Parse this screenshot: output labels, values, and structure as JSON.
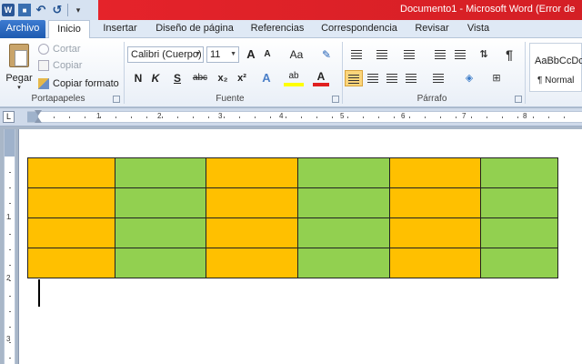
{
  "window": {
    "title": "Documento1  -  Microsoft Word (Error de"
  },
  "tabs": [
    {
      "id": "file",
      "label": "Archivo"
    },
    {
      "id": "home",
      "label": "Inicio"
    },
    {
      "id": "insert",
      "label": "Insertar"
    },
    {
      "id": "layout",
      "label": "Diseño de página"
    },
    {
      "id": "refs",
      "label": "Referencias"
    },
    {
      "id": "mail",
      "label": "Correspondencia"
    },
    {
      "id": "review",
      "label": "Revisar"
    },
    {
      "id": "view",
      "label": "Vista"
    }
  ],
  "clipboard": {
    "paste": "Pegar",
    "cut": "Cortar",
    "copy": "Copiar",
    "format_painter": "Copiar formato",
    "group": "Portapapeles"
  },
  "font": {
    "name": "Calibri (Cuerpo)",
    "size": "11",
    "group": "Fuente",
    "bold": "N",
    "italic": "K",
    "underline": "S",
    "strike": "abc",
    "subscript": "x₂",
    "superscript": "x²",
    "grow": "A",
    "shrink": "A",
    "case": "Aa",
    "color": "A",
    "effects": "A",
    "highlight": "ab"
  },
  "paragraph": {
    "group": "Párrafo",
    "pilcrow": "¶"
  },
  "styles": {
    "sample": "AaBbCcDc",
    "name": "¶ Normal"
  },
  "ruler": {
    "marks": [
      "1",
      "2",
      "3",
      "4",
      "5",
      "6",
      "7",
      "8"
    ],
    "vmarks": [
      "1",
      "2",
      "3"
    ]
  },
  "table": {
    "rows": 4,
    "cols": 6,
    "colors": [
      "#ffc000",
      "#92d050",
      "#ffc000",
      "#92d050",
      "#ffc000",
      "#92d050"
    ]
  }
}
